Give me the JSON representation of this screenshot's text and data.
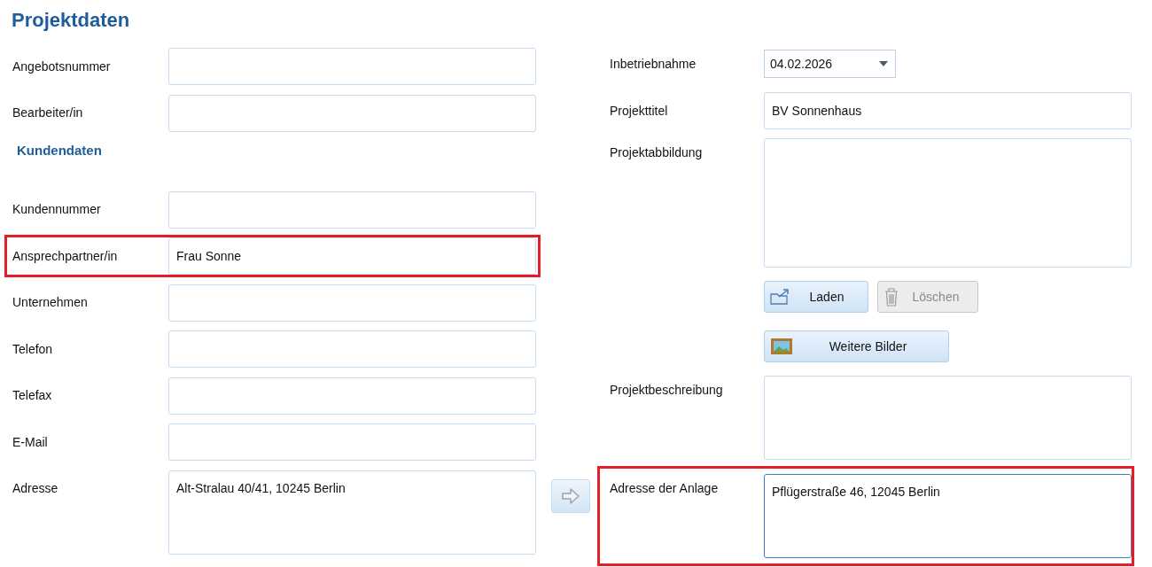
{
  "title": "Projektdaten",
  "customer_fields": [
    {
      "kind": "text",
      "label": "Angebotsnummer",
      "highlighted": false
    },
    {
      "kind": "text",
      "label": "Bearbeiter/in",
      "highlighted": false
    },
    {
      "kind": "heading",
      "label": "Kundendaten"
    },
    {
      "kind": "text",
      "label": "Kundennummer",
      "highlighted": false
    },
    {
      "kind": "text",
      "label": "Ansprechpartner/in",
      "value": "Frau Sonne",
      "highlighted": true
    },
    {
      "kind": "text",
      "label": "Unternehmen",
      "highlighted": false
    },
    {
      "kind": "text",
      "label": "Telefon",
      "highlighted": false
    },
    {
      "kind": "text",
      "label": "Telefax",
      "highlighted": false
    },
    {
      "kind": "text",
      "label": "E-Mail",
      "highlighted": false
    },
    {
      "kind": "textarea",
      "label": "Adresse",
      "value": "Alt-Stralau 40/41, 10245 Berlin",
      "highlighted": false
    }
  ],
  "project_fields": [
    {
      "kind": "date",
      "label": "Inbetriebnahme",
      "value": "04.02.2026"
    },
    {
      "kind": "text",
      "label": "Projekttitel",
      "value": "BV Sonnenhaus"
    },
    {
      "kind": "image",
      "label": "Projektabbildung"
    },
    {
      "kind": "buttons",
      "buttons": [
        {
          "kind": "load",
          "label": "Laden",
          "disabled": false
        },
        {
          "kind": "delete",
          "label": "Löschen",
          "disabled": true
        }
      ]
    },
    {
      "kind": "buttons",
      "buttons": [
        {
          "kind": "gallery",
          "label": "Weitere Bilder",
          "disabled": false
        }
      ]
    },
    {
      "kind": "textarea",
      "label": "Projektbeschreibung",
      "highlighted": false,
      "focused": false
    },
    {
      "kind": "textarea",
      "label": "Adresse der Anlage",
      "value": "Pflügerstraße 46, 12045 Berlin",
      "highlighted": true,
      "focused": true
    }
  ]
}
